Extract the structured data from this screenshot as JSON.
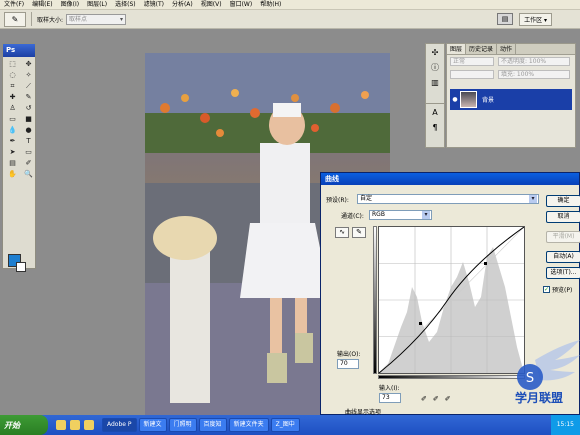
{
  "menu": [
    "文件(F)",
    "编辑(E)",
    "图像(I)",
    "图层(L)",
    "选择(S)",
    "滤镜(T)",
    "分析(A)",
    "视图(V)",
    "窗口(W)",
    "帮助(H)"
  ],
  "options": {
    "sample_label": "取样大小:",
    "sample_value": "取样点",
    "workspace": "工作区 ▾"
  },
  "toolbox": {
    "title": "Ps"
  },
  "layers_panel": {
    "tabs": [
      "图层",
      "历史记录",
      "动作"
    ],
    "blend_mode": "正常",
    "opacity": "不透明度: 100%",
    "fill": "填充: 100%",
    "layer_name": "背景"
  },
  "curves": {
    "title": "曲线",
    "preset_label": "预设(R):",
    "preset_value": "自定",
    "channel_label": "通道(C):",
    "channel_value": "RGB",
    "output_label": "输出(O):",
    "output_value": "70",
    "input_label": "输入(I):",
    "input_value": "73",
    "buttons": {
      "ok": "确定",
      "cancel": "取消",
      "smooth": "平滑(M)",
      "auto": "自动(A)",
      "options": "选项(T)..."
    },
    "preview_label": "预览(P)",
    "curve_display_label": "曲线显示选项"
  },
  "taskbar": {
    "start": "开始",
    "tasks": [
      "Adobe P",
      "新建文",
      "门照明",
      "百度知",
      "新建文件夹",
      "Z_图中"
    ],
    "clock": "15:15"
  },
  "watermark": {
    "text": "学月联盟",
    "url_text": "www.3yue.com"
  },
  "colors": {
    "foreground": "#1e7fd0",
    "title_blue": "#0a5fe0",
    "taskbar": "#245edb"
  }
}
